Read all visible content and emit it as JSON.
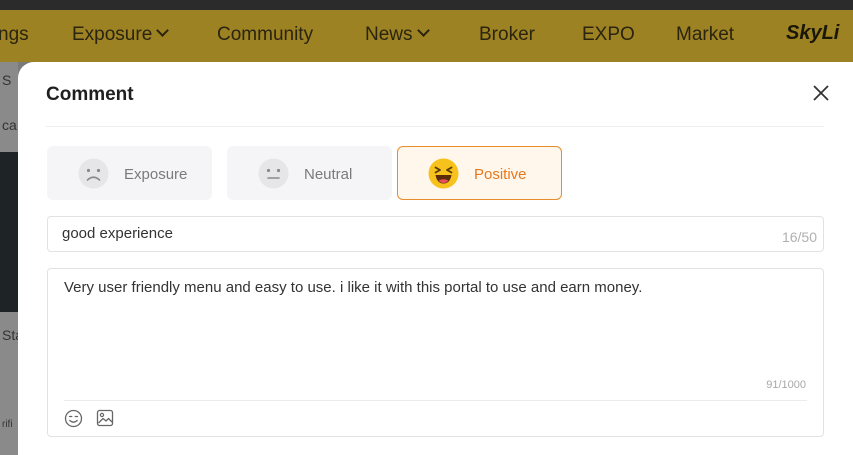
{
  "background": {
    "nav": {
      "items": [
        {
          "label": "ngs",
          "has_dropdown": false
        },
        {
          "label": "Exposure",
          "has_dropdown": true
        },
        {
          "label": "Community",
          "has_dropdown": false
        },
        {
          "label": "News",
          "has_dropdown": true
        },
        {
          "label": "Broker",
          "has_dropdown": false
        },
        {
          "label": "EXPO",
          "has_dropdown": false
        },
        {
          "label": "Market",
          "has_dropdown": false
        }
      ],
      "logo_text": "SkyLi"
    },
    "left_fragments": [
      "S",
      "ca",
      "Sta",
      "rifi"
    ]
  },
  "modal": {
    "title": "Comment",
    "close_icon": "close-icon",
    "ratings": [
      {
        "label": "Exposure",
        "icon": "sad-face-icon",
        "active": false
      },
      {
        "label": "Neutral",
        "icon": "neutral-face-icon",
        "active": false
      },
      {
        "label": "Positive",
        "icon": "laughing-face-icon",
        "active": true
      }
    ],
    "title_input": {
      "value": "good experience",
      "counter": "16/50"
    },
    "content": {
      "value": "Very user friendly menu and easy to use. i like it with this portal to use and earn money.",
      "counter": "91/1000"
    },
    "toolbar": {
      "emoji_icon": "emoji-icon",
      "image_icon": "image-icon"
    }
  },
  "colors": {
    "nav_bg": "#9c8222",
    "accent": "#e7791b",
    "active_bg": "#fff6ec",
    "inactive_bg": "#f5f5f7"
  }
}
